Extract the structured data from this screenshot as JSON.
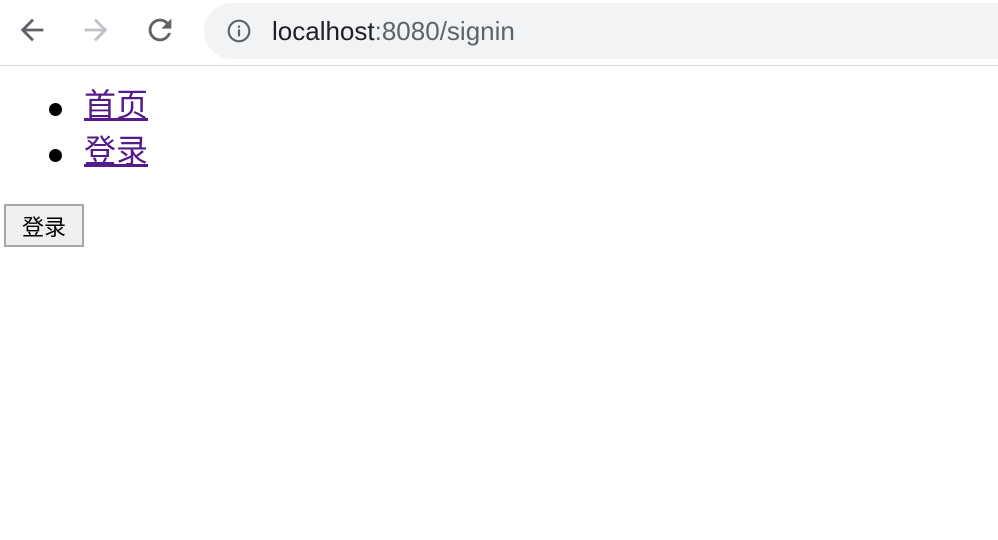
{
  "browser": {
    "url_host": "localhost",
    "url_path": ":8080/signin",
    "icons": {
      "back": "arrow-left-icon",
      "forward": "arrow-right-icon",
      "reload": "reload-icon",
      "site_info": "info-icon"
    }
  },
  "nav": {
    "items": [
      {
        "label": "首页"
      },
      {
        "label": "登录"
      }
    ]
  },
  "form": {
    "signin_label": "登录"
  },
  "colors": {
    "visited_link": "#551a8b",
    "omnibox_bg": "#f1f3f4",
    "button_bg": "#efefef"
  }
}
